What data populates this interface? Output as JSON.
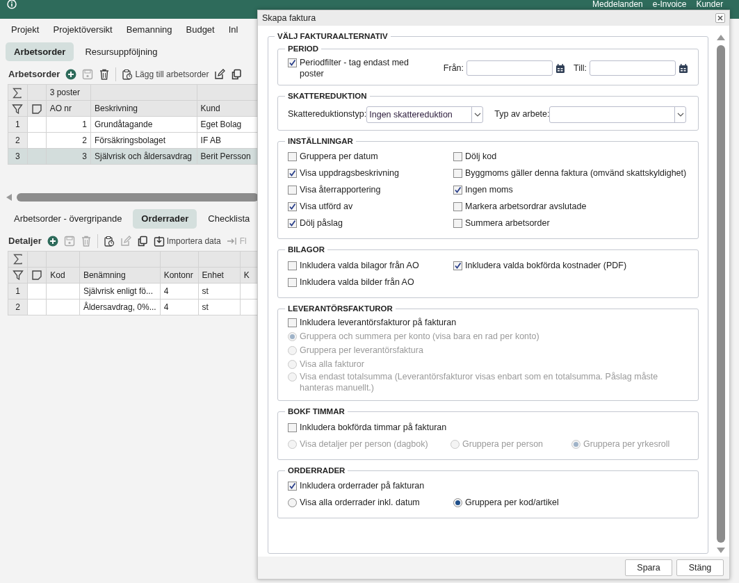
{
  "app": {
    "header_links": [
      "Meddelanden",
      "e-Invoice",
      "Kunder"
    ],
    "nav_tabs": [
      "Projekt",
      "Projektöversikt",
      "Bemanning",
      "Budget",
      "Inl"
    ],
    "sub_tabs": [
      {
        "label": "Arbetsorder",
        "selected": true
      },
      {
        "label": "Resursuppföljning",
        "selected": false
      }
    ],
    "work_orders": {
      "title": "Arbetsorder",
      "add_action": "Lägg till arbetsorder",
      "count": "3 poster",
      "columns": [
        "AO nr",
        "Beskrivning",
        "Kund"
      ],
      "rows": [
        {
          "row_number": "1",
          "cells": [
            "1",
            "Grundåtagande",
            "Eget Bolag"
          ],
          "selected": false
        },
        {
          "row_number": "2",
          "cells": [
            "2",
            "Försäkringsbolaget",
            "IF AB"
          ],
          "selected": false
        },
        {
          "row_number": "3",
          "cells": [
            "3",
            "Självrisk och åldersavdrag",
            "Berit Persson"
          ],
          "selected": true
        }
      ]
    },
    "detail_tabs": [
      {
        "label": "Arbetsorder - övergripande",
        "selected": false
      },
      {
        "label": "Orderrader",
        "selected": true
      },
      {
        "label": "Checklista",
        "selected": false
      }
    ],
    "details": {
      "title": "Detaljer",
      "import_action": "Importera data",
      "next_action": "Fl",
      "columns": [
        "Kod",
        "Benämning",
        "Kontonr",
        "Enhet",
        "K"
      ],
      "rows": [
        {
          "row_number": "1",
          "cells": [
            "",
            "Självrisk enligt fö...",
            "4",
            "st",
            ""
          ]
        },
        {
          "row_number": "2",
          "cells": [
            "",
            "Åldersavdrag, 0%...",
            "4",
            "st",
            ""
          ]
        }
      ]
    }
  },
  "dialog": {
    "title": "Skapa faktura",
    "group_title": "VÄLJ FAKTURAALTERNATIV",
    "sections": [
      {
        "title": "PERIOD",
        "rows": [
          [
            {
              "kind": "checkbox",
              "label": "Periodfilter - tag endast med poster",
              "checked": true
            },
            {
              "kind": "date",
              "label": "Från:"
            },
            {
              "kind": "date",
              "label": "Till:"
            }
          ]
        ]
      },
      {
        "title": "SKATTEREDUKTION",
        "rows": [
          [
            {
              "kind": "select",
              "label": "Skattereduktionstyp:",
              "value": "Ingen skattereduktion"
            },
            {
              "kind": "select",
              "label": "Typ av arbete:"
            }
          ]
        ]
      },
      {
        "title": "INSTÄLLNINGAR",
        "rows": [
          [
            {
              "kind": "checkbox",
              "label": "Gruppera per datum",
              "checked": false
            },
            {
              "kind": "checkbox",
              "label": "Dölj kod",
              "checked": false
            }
          ],
          [
            {
              "kind": "checkbox",
              "label": "Visa uppdragsbeskrivning",
              "checked": true
            },
            {
              "kind": "checkbox",
              "label": "Byggmoms gäller denna faktura (omvänd skattskyldighet)",
              "checked": false
            }
          ],
          [
            {
              "kind": "checkbox",
              "label": "Visa återrapportering",
              "checked": false
            },
            {
              "kind": "checkbox",
              "label": "Ingen moms",
              "checked": true
            }
          ],
          [
            {
              "kind": "checkbox",
              "label": "Visa utförd av",
              "checked": true
            },
            {
              "kind": "checkbox",
              "label": "Markera arbetsordrar avslutade",
              "checked": false
            }
          ],
          [
            {
              "kind": "checkbox",
              "label": "Dölj påslag",
              "checked": true
            },
            {
              "kind": "checkbox",
              "label": "Summera arbetsorder",
              "checked": false
            }
          ]
        ]
      },
      {
        "title": "BILAGOR",
        "rows": [
          [
            {
              "kind": "checkbox",
              "label": "Inkludera valda bilagor från AO",
              "checked": false
            },
            {
              "kind": "checkbox",
              "label": "Inkludera valda bokförda kostnader (PDF)",
              "checked": true
            }
          ],
          [
            {
              "kind": "checkbox",
              "label": "Inkludera valda bilder från AO",
              "checked": false
            }
          ]
        ]
      },
      {
        "title": "LEVERANTÖRSFAKTUROR",
        "rows": [
          [
            {
              "kind": "checkbox",
              "label": "Inkludera leverantörsfakturor på fakturan",
              "checked": false
            }
          ],
          [
            {
              "kind": "radio",
              "label": "Gruppera och summera per konto (visa bara en rad per konto)",
              "selected": true,
              "disabled": true
            }
          ],
          [
            {
              "kind": "radio",
              "label": "Gruppera per leverantörsfaktura",
              "selected": false,
              "disabled": true
            }
          ],
          [
            {
              "kind": "radio",
              "label": "Visa alla fakturor",
              "selected": false,
              "disabled": true
            }
          ],
          [
            {
              "kind": "radio",
              "label": "Visa endast totalsumma (Leverantörsfakturor visas enbart som en totalsumma. Påslag måste hanteras manuellt.)",
              "selected": false,
              "disabled": true
            }
          ]
        ]
      },
      {
        "title": "BOKF TIMMAR",
        "rows": [
          [
            {
              "kind": "checkbox",
              "label": "Inkludera bokförda timmar på fakturan",
              "checked": false
            }
          ],
          [
            {
              "kind": "radio",
              "label": "Visa detaljer per person (dagbok)",
              "selected": false,
              "disabled": true
            },
            {
              "kind": "radio",
              "label": "Gruppera per person",
              "selected": false,
              "disabled": true
            },
            {
              "kind": "radio",
              "label": "Gruppera per yrkesroll",
              "selected": true,
              "disabled": true
            }
          ]
        ]
      },
      {
        "title": "ORDERRADER",
        "rows": [
          [
            {
              "kind": "checkbox",
              "label": "Inkludera orderrader på fakturan",
              "checked": true
            }
          ],
          [
            {
              "kind": "radio",
              "label": "Visa alla orderrader inkl. datum",
              "selected": false,
              "disabled": false
            },
            {
              "kind": "radio",
              "label": "Gruppera per kod/artikel",
              "selected": true,
              "disabled": false
            }
          ]
        ]
      }
    ],
    "buttons": [
      "Spara",
      "Stäng"
    ]
  }
}
